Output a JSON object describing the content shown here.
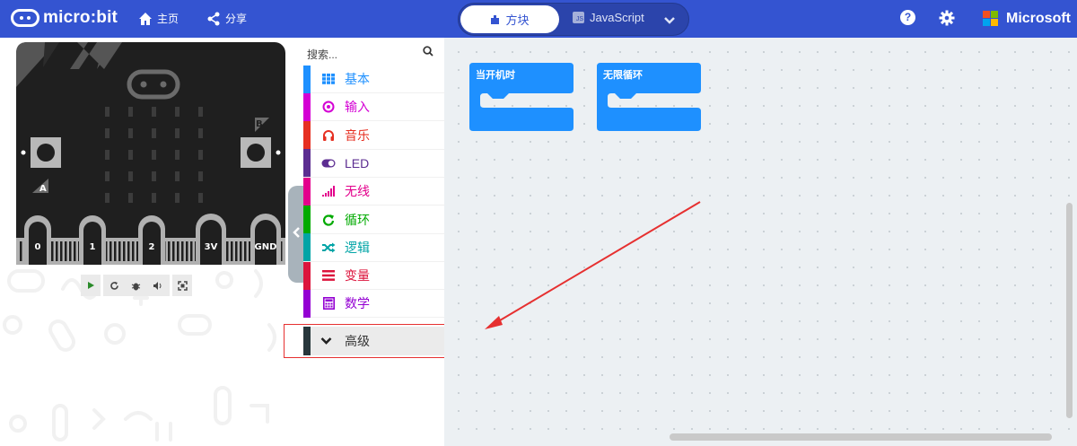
{
  "header": {
    "brand": "micro:bit",
    "home_label": "主页",
    "share_label": "分享",
    "mode_blocks": "方块",
    "mode_js": "JavaScript",
    "help_glyph": "?",
    "ms_label": "Microsoft",
    "ms_colors": [
      "#f25022",
      "#7fba00",
      "#00a4ef",
      "#ffb900"
    ]
  },
  "simulator": {
    "button_a": "A",
    "button_b": "B",
    "pins": [
      "0",
      "1",
      "2",
      "3V",
      "GND"
    ],
    "controls": [
      "play-icon",
      "restart-icon",
      "debug-icon",
      "sound-icon",
      "fullscreen-icon"
    ]
  },
  "toolbox": {
    "search_placeholder": "搜索...",
    "categories": [
      {
        "label": "基本",
        "color": "#1e90ff",
        "icon": "grid-icon"
      },
      {
        "label": "输入",
        "color": "#d400d4",
        "icon": "input-icon"
      },
      {
        "label": "音乐",
        "color": "#e63022",
        "icon": "headphones-icon"
      },
      {
        "label": "LED",
        "color": "#5c2d91",
        "icon": "toggle-icon"
      },
      {
        "label": "无线",
        "color": "#e3008c",
        "icon": "signal-icon"
      },
      {
        "label": "循环",
        "color": "#00aa00",
        "icon": "loop-icon"
      },
      {
        "label": "逻辑",
        "color": "#00a4a6",
        "icon": "shuffle-icon"
      },
      {
        "label": "变量",
        "color": "#dc143c",
        "icon": "lines-icon"
      },
      {
        "label": "数学",
        "color": "#9400d3",
        "icon": "calculator-icon"
      }
    ],
    "advanced_label": "高级"
  },
  "workspace": {
    "blocks": [
      {
        "label": "当开机时"
      },
      {
        "label": "无限循环"
      }
    ],
    "block_color": "#1e90ff"
  }
}
